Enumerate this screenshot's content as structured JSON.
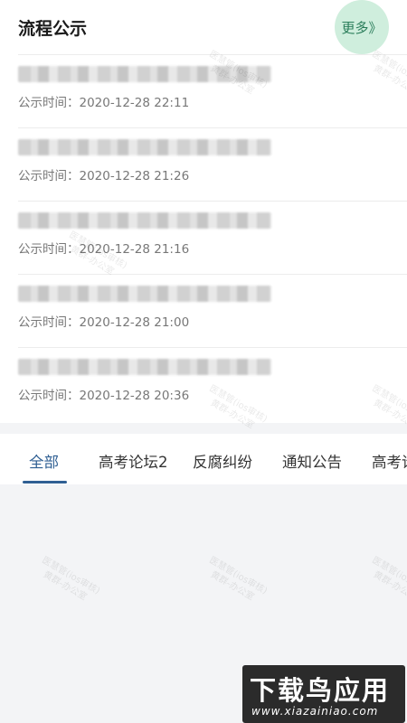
{
  "header": {
    "title": "流程公示",
    "more_label": "更多》"
  },
  "list": {
    "time_prefix": "公示时间：",
    "items": [
      {
        "time": "2020-12-28 22:11"
      },
      {
        "time": "2020-12-28 21:26"
      },
      {
        "time": "2020-12-28 21:16"
      },
      {
        "time": "2020-12-28 21:00"
      },
      {
        "time": "2020-12-28 20:36"
      }
    ]
  },
  "tabs": [
    "全部",
    "高考论坛2",
    "反腐纠纷",
    "通知公告",
    "高考论"
  ],
  "active_tab": 0,
  "watermark": [
    "医慧管(ios审核)",
    "黄群-办公室"
  ],
  "brand": {
    "main": "下载鸟应用",
    "sub": "www.xiazainiao.com"
  },
  "colors": {
    "accent": "#2f5f93",
    "more_bg": "#cfeedd",
    "more_text": "#2a7d5a"
  }
}
